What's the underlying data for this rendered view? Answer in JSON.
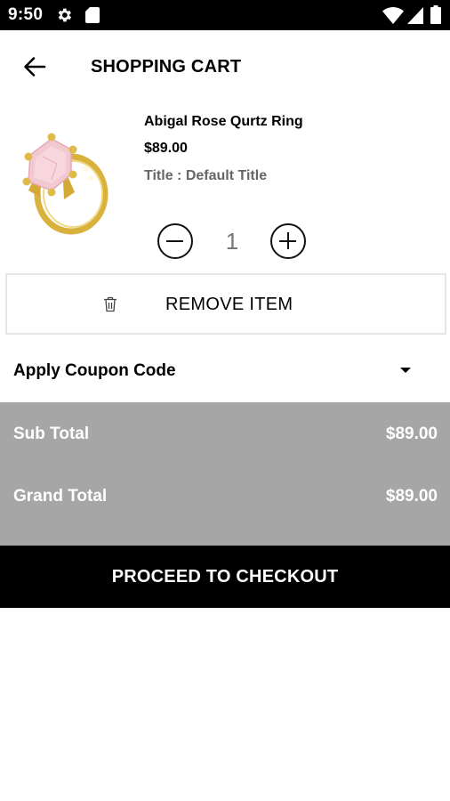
{
  "status_bar": {
    "time": "9:50",
    "icons": [
      "gear-icon",
      "sd-card-icon",
      "wifi-icon",
      "signal-icon",
      "battery-icon"
    ]
  },
  "header": {
    "back_icon": "arrow-left-icon",
    "title": "SHOPPING CART"
  },
  "cart": {
    "items": [
      {
        "image_icon": "rose-quartz-ring-image",
        "name": "Abigal Rose Qurtz Ring",
        "price": "$89.00",
        "variant": "Title : Default Title",
        "quantity": "1",
        "remove_label": "REMOVE ITEM",
        "remove_icon": "trash-icon"
      }
    ]
  },
  "coupon": {
    "label": "Apply Coupon Code",
    "icon": "dropdown-arrow-icon"
  },
  "totals": {
    "sub_total_label": "Sub Total",
    "sub_total_value": "$89.00",
    "grand_total_label": "Grand Total",
    "grand_total_value": "$89.00"
  },
  "checkout": {
    "label": "PROCEED TO CHECKOUT"
  },
  "colors": {
    "status_bar_bg": "#000000",
    "totals_bg": "#a6a6a6",
    "checkout_bg": "#000000",
    "variant_text": "#666666"
  }
}
